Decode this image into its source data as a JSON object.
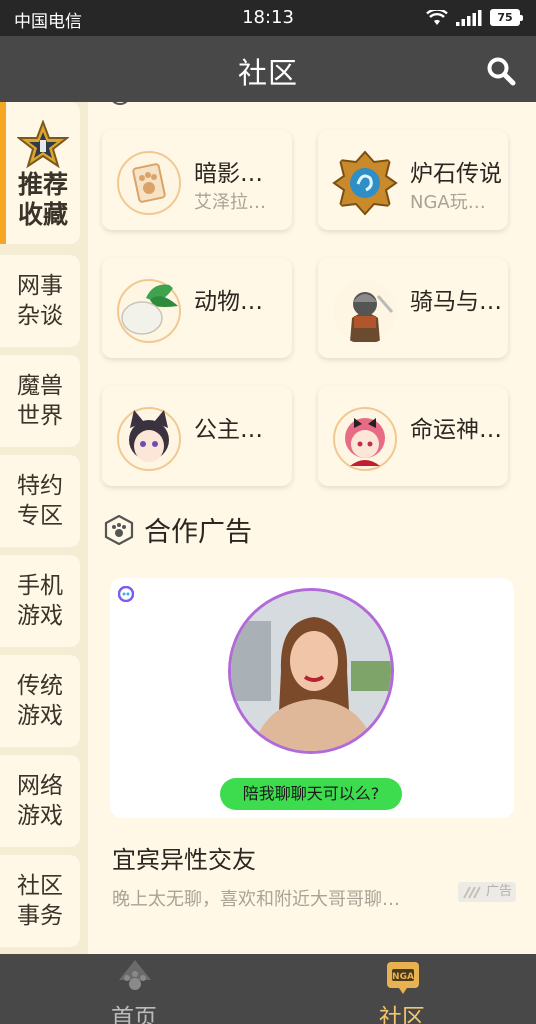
{
  "status_bar": {
    "carrier": "中国电信",
    "time": "18:13",
    "battery": "75"
  },
  "header": {
    "title": "社区"
  },
  "sidebar": {
    "items": [
      {
        "label": "推荐收藏",
        "active": true
      },
      {
        "label": "网事杂谈"
      },
      {
        "label": "魔兽世界"
      },
      {
        "label": "特约专区"
      },
      {
        "label": "手机游戏"
      },
      {
        "label": "传统游戏"
      },
      {
        "label": "网络游戏"
      },
      {
        "label": "社区事务"
      }
    ]
  },
  "forums": [
    {
      "name": "暗影…",
      "sub": "艾泽拉…",
      "icon": "paw-card-icon"
    },
    {
      "name": "炉石传说",
      "sub": "NGA玩…",
      "icon": "hearthstone-icon"
    },
    {
      "name": "动物…",
      "sub": "",
      "icon": "turnip-icon"
    },
    {
      "name": "骑马与…",
      "sub": "",
      "icon": "knight-icon"
    },
    {
      "name": "公主…",
      "sub": "",
      "icon": "catgirl-icon"
    },
    {
      "name": "命运神…",
      "sub": "",
      "icon": "pink-hair-girl-icon"
    }
  ],
  "ad_section": {
    "title": "合作广告",
    "ad": {
      "pill_text": "陪我聊聊天可以么?",
      "headline": "宜宾异性交友",
      "description": "晚上太无聊，喜欢和附近大哥哥聊…",
      "badge": "广告"
    }
  },
  "tab_bar": {
    "tabs": [
      {
        "label": "首页",
        "icon": "home-paw-icon"
      },
      {
        "label": "社区",
        "icon": "nga-community-icon",
        "active": true
      }
    ]
  },
  "colors": {
    "accent": "#f5a623",
    "nav": "#484848",
    "background": "#fff8e7",
    "active_tab": "#f4c56d"
  }
}
